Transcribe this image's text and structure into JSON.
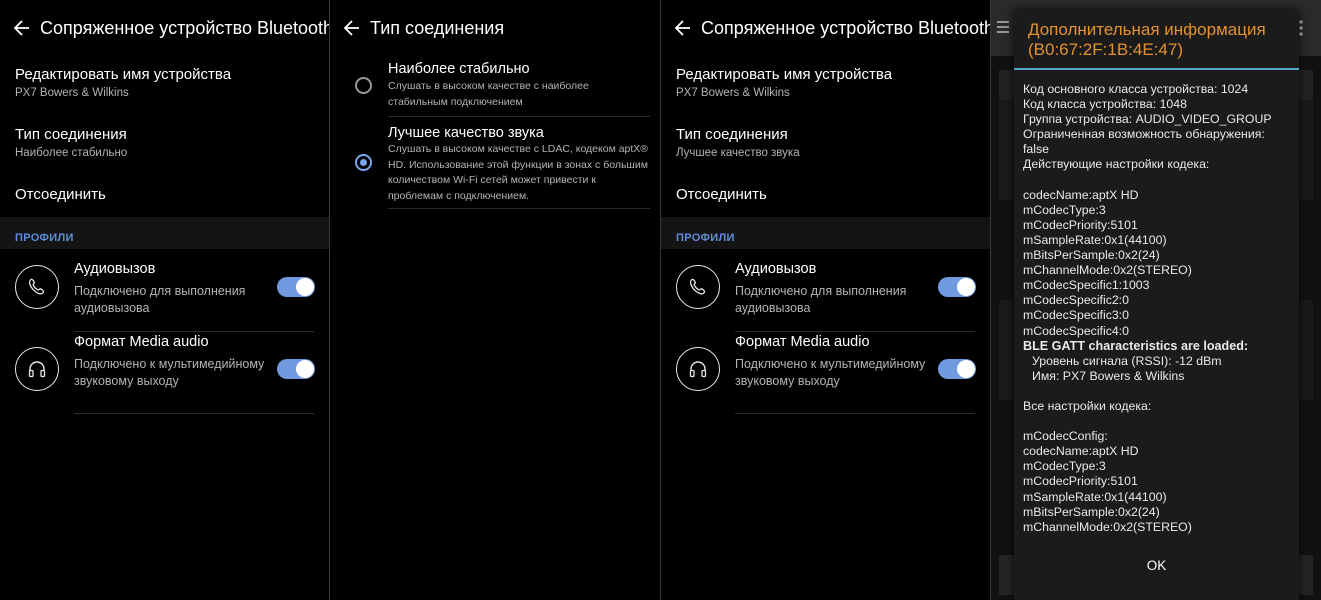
{
  "panel1": {
    "title": "Сопряженное устройство Bluetooth",
    "rows": [
      {
        "title": "Редактировать имя устройства",
        "sub": "PX7 Bowers & Wilkins"
      },
      {
        "title": "Тип соединения",
        "sub": "Наиболее стабильно"
      },
      {
        "title": "Отсоединить",
        "sub": ""
      }
    ],
    "section": "ПРОФИЛИ",
    "profiles": [
      {
        "title": "Аудиовызов",
        "sub": "Подключено для выполнения аудиовызова",
        "icon": "phone-icon",
        "enabled": true
      },
      {
        "title": "Формат Media audio",
        "sub": "Подключено к мультимедийному звуковому выходу",
        "icon": "headphones-icon",
        "enabled": true
      }
    ]
  },
  "panel2": {
    "title": "Тип соединения",
    "options": [
      {
        "title": "Наиболее стабильно",
        "desc": "Слушать в высоком качестве с наиболее стабильным подключением",
        "selected": false
      },
      {
        "title": "Лучшее качество звука",
        "desc": "Слушать в высоком качестве с LDAC, кодеком aptX® HD. Использование этой функции в зонах с большим количеством Wi-Fi сетей может привести к проблемам с подключением.",
        "selected": true
      }
    ]
  },
  "panel3": {
    "title": "Сопряженное устройство Bluetooth",
    "rows": [
      {
        "title": "Редактировать имя устройства",
        "sub": "PX7 Bowers & Wilkins"
      },
      {
        "title": "Тип соединения",
        "sub": "Лучшее качество звука"
      },
      {
        "title": "Отсоединить",
        "sub": ""
      }
    ],
    "section": "ПРОФИЛИ",
    "profiles": [
      {
        "title": "Аудиовызов",
        "sub": "Подключено для выполнения аудиовызова",
        "icon": "phone-icon",
        "enabled": true
      },
      {
        "title": "Формат Media audio",
        "sub": "Подключено к мультимедийному звуковому выходу",
        "icon": "headphones-icon",
        "enabled": true
      }
    ]
  },
  "dialog": {
    "title_line1": "Дополнительная информация",
    "title_line2": "(B0:67:2F:1B:4E:47)",
    "ok": "OK",
    "lines": {
      "l1": "Код основного класса устройства: 1024",
      "l2": "Код класса устройства: 1048",
      "l3": "Группа устройства: AUDIO_VIDEO_GROUP",
      "l4": "Ограниченная возможность обнаружения: false",
      "l5": "Действующие настройки кодека:",
      "l6": "codecName:aptX HD",
      "l7": "mCodecType:3",
      "l8": "mCodecPriority:5101",
      "l9": "mSampleRate:0x1(44100)",
      "l10": "mBitsPerSample:0x2(24)",
      "l11": "mChannelMode:0x2(STEREO)",
      "l12": "mCodecSpecific1:1003",
      "l13": "mCodecSpecific2:0",
      "l14": "mCodecSpecific3:0",
      "l15": "mCodecSpecific4:0",
      "l16": "BLE GATT characteristics are loaded:",
      "l17": "Уровень сигнала (RSSI): -12 dBm",
      "l18": "Имя: PX7 Bowers & Wilkins",
      "l19": "Все настройки кодека:",
      "l20": "mCodecConfig:",
      "l21": "codecName:aptX HD",
      "l22": "mCodecType:3",
      "l23": "mCodecPriority:5101",
      "l24": "mSampleRate:0x1(44100)",
      "l25": "mBitsPerSample:0x2(24)",
      "l26": "mChannelMode:0x2(STEREO)"
    }
  },
  "colors": {
    "accent": "#6f9ae0",
    "section": "#5f8dd9",
    "dialog_title": "#e4912f",
    "dialog_rule": "#5aa5c8"
  }
}
